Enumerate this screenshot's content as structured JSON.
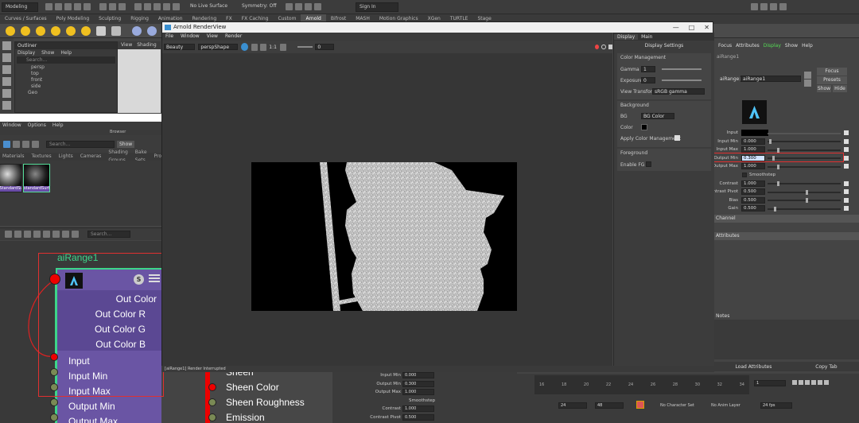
{
  "maya": {
    "workspace": "Modeling",
    "surface_menu": "No Live Surface",
    "symmetry": "Symmetry: Off",
    "sign_in": "Sign In",
    "shelf_tabs": [
      "Curves / Surfaces",
      "Poly Modeling",
      "Sculpting",
      "Rigging",
      "Animation",
      "Rendering",
      "FX",
      "FX Caching",
      "Custom",
      "Arnold",
      "Bifrost",
      "MASH",
      "Motion Graphics",
      "XGen",
      "TURTLE",
      "Stage"
    ],
    "active_shelf": "Arnold"
  },
  "outliner": {
    "title": "Outliner",
    "menu": [
      "Display",
      "Show",
      "Help"
    ],
    "search_placeholder": "Search...",
    "items": [
      "persp",
      "top",
      "front",
      "side",
      "Geo"
    ]
  },
  "viewport": {
    "menu": [
      "View",
      "Shading"
    ]
  },
  "hypershade": {
    "menu": [
      "Window",
      "Options",
      "Help"
    ],
    "browser_label": "Browser",
    "search_placeholder": "Search...",
    "show_btn": "Show",
    "tabs": [
      "Materials",
      "Textures",
      "Lights",
      "Cameras",
      "Shading Groups",
      "Bake Sets",
      "Projects"
    ],
    "swatches": [
      "aiStandardSurf1",
      "standardSurface1"
    ],
    "graph_search": "Search..."
  },
  "node": {
    "title": "aiRange1",
    "outputs": [
      "Out Color",
      "Out Color R",
      "Out Color G",
      "Out Color B"
    ],
    "inputs": [
      "Input",
      "Input Min",
      "Input Max",
      "Output Min",
      "Output Max"
    ]
  },
  "shader_node": {
    "items": [
      "Sheen",
      "Sheen Color",
      "Sheen Roughness",
      "Emission"
    ]
  },
  "renderview": {
    "title": "Arnold RenderView",
    "menu": [
      "File",
      "Window",
      "View",
      "Render"
    ],
    "aov": "Beauty",
    "camera": "perspShape",
    "ratio": "1:1",
    "exposure": "0",
    "status": "[aiRange1] Render Interrupted"
  },
  "display_settings": {
    "tabs": [
      "Display",
      "Main"
    ],
    "title": "Display Settings",
    "color_management": "Color Management",
    "gamma_label": "Gamma",
    "gamma": "1",
    "exposure_label": "Exposure",
    "exposure": "0",
    "view_transform_label": "View Transform",
    "view_transform": "sRGB gamma",
    "background": "Background",
    "bg_label": "BG",
    "bg_value": "BG Color",
    "color_label": "Color",
    "apply_cm": "Apply Color Management",
    "foreground": "Foreground",
    "enable_fg": "Enable FG"
  },
  "attribute_editor": {
    "menu": [
      "Focus",
      "Attributes",
      "Display",
      "Show",
      "Help"
    ],
    "tab": "aiRange1",
    "node_label": "aiRange:",
    "node_value": "aiRange1",
    "focus_btn": "Focus",
    "presets_btn": "Presets",
    "show_btn": "Show",
    "hide_btn": "Hide",
    "rows": [
      {
        "label": "Input",
        "value": ""
      },
      {
        "label": "Input Min",
        "value": "0.000"
      },
      {
        "label": "Input Max",
        "value": "1.000"
      },
      {
        "label": "Output Min",
        "value": "0.300"
      },
      {
        "label": "Output Max",
        "value": "1.000"
      },
      {
        "label": "Smoothstep",
        "value": ""
      },
      {
        "label": "Contrast",
        "value": "1.000"
      },
      {
        "label": "Contrast Pivot",
        "value": "0.500"
      },
      {
        "label": "Bias",
        "value": "0.500"
      },
      {
        "label": "Gain",
        "value": "0.500"
      }
    ],
    "sections": [
      "Channel",
      "Attributes"
    ],
    "notes_label": "Notes",
    "load_btn": "Load Attributes",
    "copy_btn": "Copy Tab"
  },
  "mid_attr": {
    "rows": [
      {
        "label": "Input Min",
        "value": "0.000"
      },
      {
        "label": "Output Min",
        "value": "0.300"
      },
      {
        "label": "Output Max",
        "value": "1.000"
      },
      {
        "label": "Smoothstep",
        "value": ""
      },
      {
        "label": "Contrast",
        "value": "1.000"
      },
      {
        "label": "Contrast Pivot",
        "value": "0.500"
      }
    ]
  },
  "timeline": {
    "ticks": [
      "16",
      "18",
      "20",
      "22",
      "24",
      "26",
      "28",
      "30",
      "32",
      "34"
    ],
    "current": "1",
    "start": "24",
    "end": "48",
    "char_set": "No Character Set",
    "anim_layer": "No Anim Layer",
    "fps": "24 fps"
  }
}
